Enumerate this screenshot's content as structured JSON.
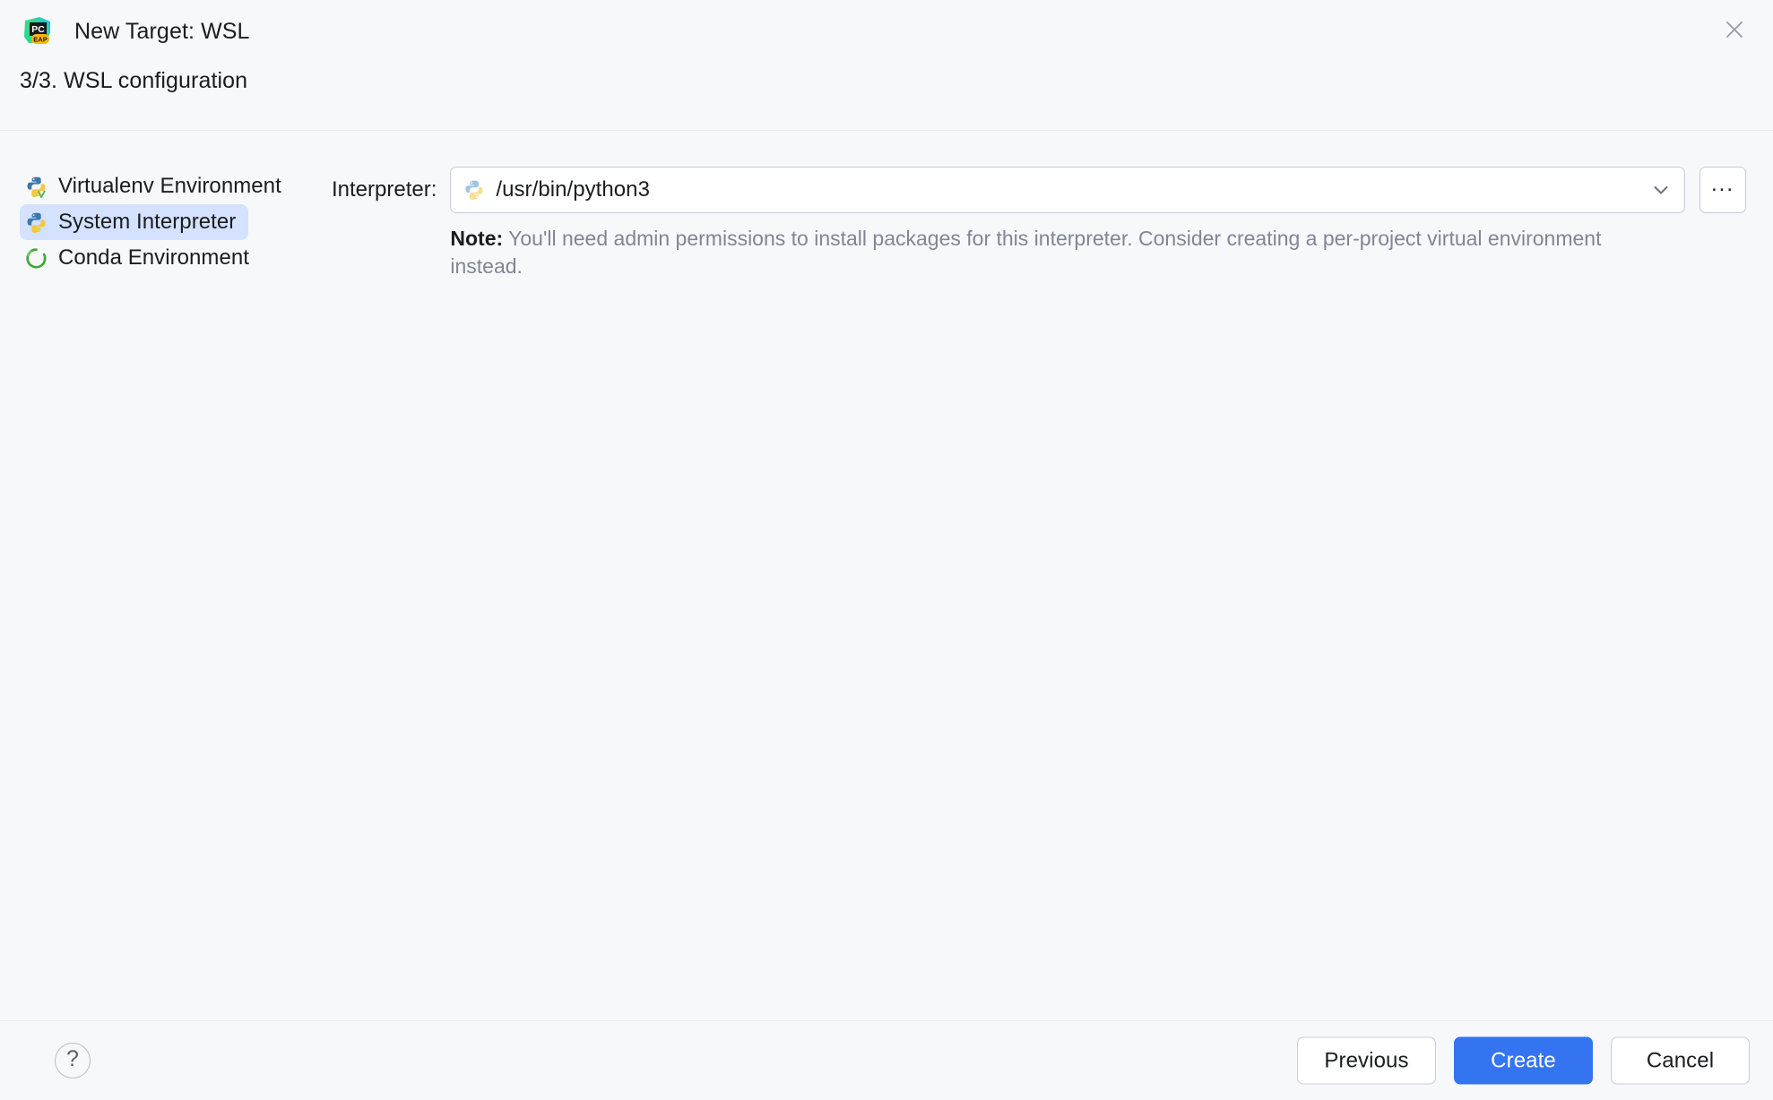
{
  "window": {
    "title": "New Target: WSL",
    "app_icon": "pycharm-eap-icon",
    "close_icon": "close-icon"
  },
  "step": {
    "title": "3/3. WSL configuration"
  },
  "environment_list": {
    "items": [
      {
        "label": "Virtualenv Environment",
        "icon": "python-virtualenv-icon",
        "selected": false
      },
      {
        "label": "System Interpreter",
        "icon": "python-icon",
        "selected": true
      },
      {
        "label": "Conda Environment",
        "icon": "conda-icon",
        "selected": false
      }
    ]
  },
  "interpreter_field": {
    "label": "Interpreter:",
    "value": "/usr/bin/python3",
    "placeholder": "",
    "icon": "python-icon",
    "dropdown_icon": "chevron-down-icon",
    "browse_label": "...",
    "note_label": "Note:",
    "note_text": "You'll need admin permissions to install packages for this interpreter. Consider creating a per-project virtual environment instead."
  },
  "footer": {
    "help_label": "?",
    "previous_label": "Previous",
    "create_label": "Create",
    "cancel_label": "Cancel"
  },
  "colors": {
    "accent": "#3574F0",
    "selection": "#D4E2FF",
    "background": "#F7F8FA",
    "text": "#1B1C1E",
    "muted_text": "#818594",
    "border": "#C9CCD6"
  }
}
